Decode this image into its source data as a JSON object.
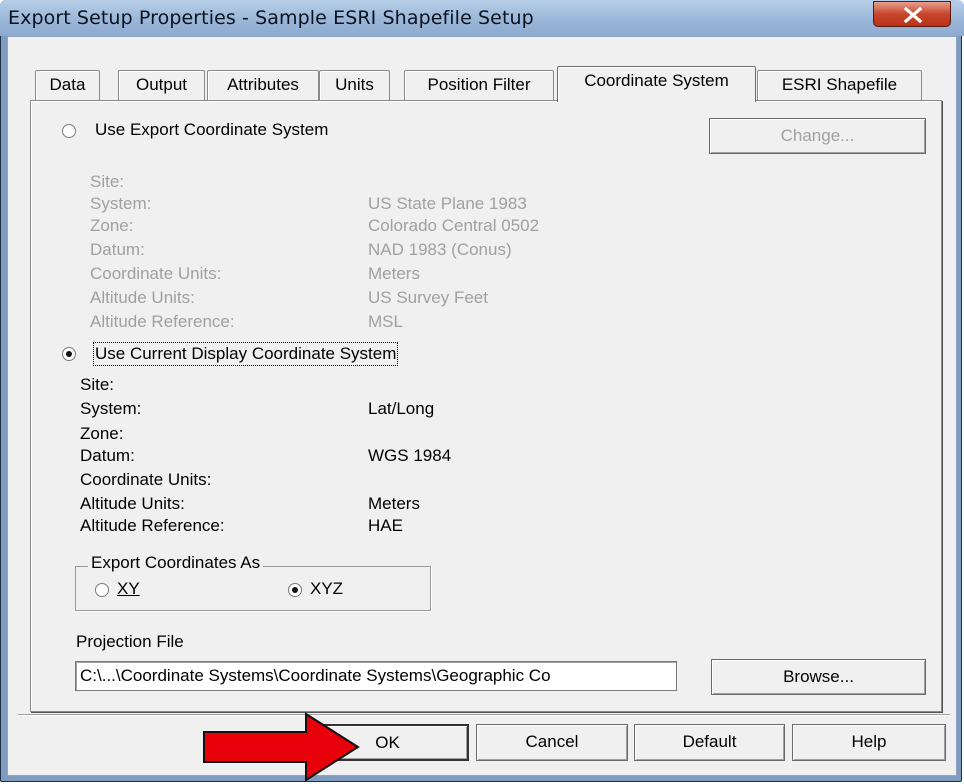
{
  "window": {
    "title": "Export Setup Properties - Sample ESRI Shapefile Setup",
    "close_icon": "close-icon",
    "accent": "#c8462b"
  },
  "tabs": [
    {
      "label": "Data",
      "active": false
    },
    {
      "label": "Output",
      "active": false
    },
    {
      "label": "Attributes",
      "active": false
    },
    {
      "label": "Units",
      "active": false
    },
    {
      "label": "Position Filter",
      "active": false
    },
    {
      "label": "Coordinate System",
      "active": true
    },
    {
      "label": "ESRI Shapefile",
      "active": false
    }
  ],
  "export_cs": {
    "radio_label": "Use Export Coordinate System",
    "selected": false,
    "change_button": "Change...",
    "fields": [
      {
        "label": "Site:",
        "value": ""
      },
      {
        "label": "System:",
        "value": "US State Plane 1983"
      },
      {
        "label": "Zone:",
        "value": "Colorado Central 0502"
      },
      {
        "label": "Datum:",
        "value": "NAD 1983 (Conus)"
      },
      {
        "label": "Coordinate Units:",
        "value": "Meters"
      },
      {
        "label": "Altitude Units:",
        "value": "US Survey Feet"
      },
      {
        "label": "Altitude Reference:",
        "value": "MSL"
      }
    ]
  },
  "display_cs": {
    "radio_label": "Use Current Display Coordinate System",
    "selected": true,
    "fields": [
      {
        "label": "Site:",
        "value": ""
      },
      {
        "label": "System:",
        "value": "Lat/Long"
      },
      {
        "label": "Zone:",
        "value": ""
      },
      {
        "label": "Datum:",
        "value": "WGS 1984"
      },
      {
        "label": "Coordinate Units:",
        "value": ""
      },
      {
        "label": "Altitude Units:",
        "value": "Meters"
      },
      {
        "label": "Altitude Reference:",
        "value": "HAE"
      }
    ]
  },
  "export_coords": {
    "group_title": "Export Coordinates As",
    "options": [
      {
        "label": "XY",
        "selected": false
      },
      {
        "label": "XYZ",
        "selected": true
      }
    ]
  },
  "projection": {
    "label": "Projection File",
    "value": "C:\\...\\Coordinate Systems\\Coordinate Systems\\Geographic Co",
    "browse_button": "Browse..."
  },
  "buttons": {
    "ok": "OK",
    "cancel": "Cancel",
    "default": "Default",
    "help": "Help"
  },
  "annotation": {
    "arrow_icon": "arrow-right-icon",
    "arrow_color": "#e8000b"
  }
}
